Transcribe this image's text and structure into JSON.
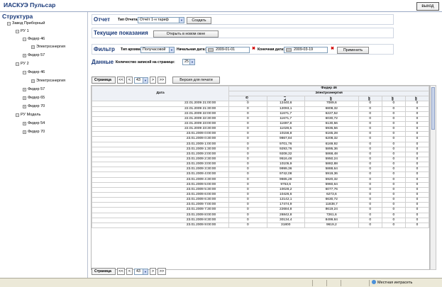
{
  "app": {
    "title": "ИАСКУЭ Пульсар",
    "exit_label": "выход"
  },
  "sidebar": {
    "title": "Структура",
    "tree": [
      {
        "label": "Завод Приборный",
        "level": 0,
        "toggle": "−"
      },
      {
        "label": "РУ 1",
        "level": 1,
        "toggle": "−"
      },
      {
        "label": "Фидер 46",
        "level": 2,
        "toggle": "−"
      },
      {
        "label": "Электроэнергия",
        "level": 3,
        "toggle": "+"
      },
      {
        "label": "Фидер 57",
        "level": 2,
        "toggle": "+"
      },
      {
        "label": "РУ 2",
        "level": 1,
        "toggle": "−"
      },
      {
        "label": "Фидер 46",
        "level": 2,
        "toggle": "−"
      },
      {
        "label": "Электроэнергия",
        "level": 3,
        "toggle": "+"
      },
      {
        "label": "Фидер 57",
        "level": 2,
        "toggle": "+"
      },
      {
        "label": "Фидер 65",
        "level": 2,
        "toggle": "+"
      },
      {
        "label": "Фидер 70",
        "level": 2,
        "toggle": "+"
      },
      {
        "label": "РУ Модель",
        "level": 1,
        "toggle": "−"
      },
      {
        "label": "Фидер 54",
        "level": 2,
        "toggle": "+"
      },
      {
        "label": "Фидер 70",
        "level": 2,
        "toggle": "+"
      }
    ]
  },
  "report": {
    "label": "Отчет",
    "type_label": "Тип Отчета:",
    "type_value": "Отчёт 1-н тариф",
    "create_label": "Создать"
  },
  "current": {
    "label": "Текущие показания",
    "open_label": "Открыть в новом окне"
  },
  "filter": {
    "label": "Фильтр",
    "archive_label": "Тип архива:",
    "archive_value": "Получасовой",
    "start_label": "Начальная дата:",
    "start_value": "2009-01-01",
    "end_label": "Конечная дата:",
    "end_value": "2009-03-19",
    "apply_label": "Применить"
  },
  "data_section": {
    "label": "Данные",
    "per_page_label": "Количество записей на странице:",
    "per_page_value": "25"
  },
  "pager": {
    "label": "Страница",
    "first": "<<",
    "prev": "<",
    "page": "43",
    "next": ">",
    "last": ">>",
    "print_label": "Версия для печати"
  },
  "table": {
    "group_header": "Фидер 46",
    "sub_header": "Электроэнергия",
    "date_header": "Дата",
    "columns": [
      "Акт. Вид.",
      "Актив. Потр.",
      "Реакт1.",
      "Реакт2.",
      "Реакт3.",
      "Реакт4."
    ],
    "rows": [
      [
        "22.01.2009 21:00:00",
        "0",
        "12440,6",
        "7089,6",
        "0",
        "0",
        "0"
      ],
      [
        "22.01.2009 21:30:00",
        "0",
        "12093,1",
        "6808,32",
        "0",
        "0",
        "0"
      ],
      [
        "22.01.2009 22:00:00",
        "0",
        "11671,7",
        "6227,52",
        "0",
        "0",
        "0"
      ],
      [
        "22.01.2009 22:30:00",
        "0",
        "11671,7",
        "6030,72",
        "0",
        "0",
        "0"
      ],
      [
        "22.01.2009 23:00:00",
        "0",
        "11697,8",
        "6130,56",
        "0",
        "0",
        "0"
      ],
      [
        "22.01.2009 23:30:00",
        "0",
        "11028,5",
        "5936,56",
        "0",
        "0",
        "0"
      ],
      [
        "23.01.2009 0:00:00",
        "0",
        "10156,8",
        "6165,28",
        "0",
        "0",
        "0"
      ],
      [
        "23.01.2009 0:30:00",
        "0",
        "9867,84",
        "6208,32",
        "0",
        "0",
        "0"
      ],
      [
        "23.01.2009 1:00:00",
        "0",
        "9701,76",
        "6169,92",
        "0",
        "0",
        "0"
      ],
      [
        "23.01.2009 1:30:00",
        "0",
        "9293,76",
        "5895,36",
        "0",
        "0",
        "0"
      ],
      [
        "23.01.2009 2:00:00",
        "0",
        "9208,32",
        "5868,48",
        "0",
        "0",
        "0"
      ],
      [
        "23.01.2009 2:30:00",
        "0",
        "9516,48",
        "5950,24",
        "0",
        "0",
        "0"
      ],
      [
        "23.01.2009 3:00:00",
        "0",
        "10105,9",
        "5882,88",
        "0",
        "0",
        "0"
      ],
      [
        "23.01.2009 3:30:00",
        "0",
        "9999,36",
        "5888,64",
        "0",
        "0",
        "0"
      ],
      [
        "23.01.2009 4:00:00",
        "0",
        "9742,08",
        "5919,36",
        "0",
        "0",
        "0"
      ],
      [
        "23.01.2009 4:30:00",
        "0",
        "9665,28",
        "5920,32",
        "0",
        "0",
        "0"
      ],
      [
        "23.01.2009 5:00:00",
        "0",
        "9753,6",
        "5960,64",
        "0",
        "0",
        "0"
      ],
      [
        "23.01.2009 5:30:00",
        "0",
        "10028,2",
        "6077,76",
        "0",
        "0",
        "0"
      ],
      [
        "23.01.2009 6:00:00",
        "0",
        "10426,6",
        "6273,6",
        "0",
        "0",
        "0"
      ],
      [
        "23.01.2009 6:30:00",
        "0",
        "12142,1",
        "6630,72",
        "0",
        "0",
        "0"
      ],
      [
        "23.01.2009 7:00:00",
        "0",
        "17474,9",
        "11838,7",
        "0",
        "0",
        "0"
      ],
      [
        "23.01.2009 7:30:00",
        "0",
        "22684,8",
        "8619,24",
        "0",
        "0",
        "0"
      ],
      [
        "23.01.2009 8:00:00",
        "0",
        "26842,8",
        "7261,6",
        "0",
        "0",
        "0"
      ],
      [
        "23.01.2009 8:30:00",
        "0",
        "30134,4",
        "8499,84",
        "0",
        "0",
        "0"
      ],
      [
        "23.01.2009 9:00:00",
        "0",
        "31800",
        "9619,2",
        "0",
        "0",
        "0"
      ]
    ]
  },
  "status": {
    "zone": "Местная интрасеть"
  }
}
